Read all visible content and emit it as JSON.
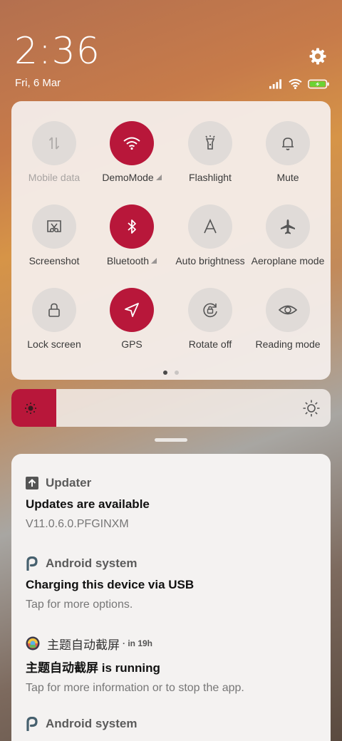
{
  "status": {
    "time": "2:36",
    "date": "Fri, 6 Mar",
    "icons": [
      "signal-icon",
      "wifi-icon",
      "battery-charging-icon"
    ]
  },
  "quick_settings": {
    "tiles": [
      {
        "label": "Mobile data",
        "icon": "mobile-data-icon",
        "active": false,
        "dim": true
      },
      {
        "label": "DemoMode",
        "icon": "wifi-icon",
        "active": true,
        "expandable": true
      },
      {
        "label": "Flashlight",
        "icon": "flashlight-icon",
        "active": false
      },
      {
        "label": "Mute",
        "icon": "bell-icon",
        "active": false
      },
      {
        "label": "Screenshot",
        "icon": "screenshot-icon",
        "active": false
      },
      {
        "label": "Bluetooth",
        "icon": "bluetooth-icon",
        "active": true,
        "expandable": true
      },
      {
        "label": "Auto brightness",
        "icon": "auto-brightness-icon",
        "active": false
      },
      {
        "label": "Aeroplane mode",
        "icon": "airplane-icon",
        "active": false
      },
      {
        "label": "Lock screen",
        "icon": "lock-icon",
        "active": false
      },
      {
        "label": "GPS",
        "icon": "gps-icon",
        "active": true
      },
      {
        "label": "Rotate off",
        "icon": "rotate-lock-icon",
        "active": false
      },
      {
        "label": "Reading mode",
        "icon": "eye-icon",
        "active": false
      }
    ],
    "page_count": 2,
    "current_page": 1
  },
  "brightness": {
    "level_fraction": 0.14
  },
  "notifications": [
    {
      "app": "Updater",
      "icon": "updater-icon",
      "title": "Updates are available",
      "text": "V11.0.6.0.PFGINXM"
    },
    {
      "app": "Android system",
      "icon": "android-system-icon",
      "title": "Charging this device via USB",
      "text": "Tap for more options."
    },
    {
      "app": "主题自动截屏",
      "meta": "· in 19h",
      "icon": "theme-app-icon",
      "title": "主题自动截屏 is running",
      "text": "Tap for more information or to stop the app."
    },
    {
      "app": "Android system",
      "icon": "android-system-icon",
      "title": "",
      "text": ""
    }
  ],
  "colors": {
    "accent": "#b8173a",
    "tile_inactive": "#e0dbd8"
  }
}
